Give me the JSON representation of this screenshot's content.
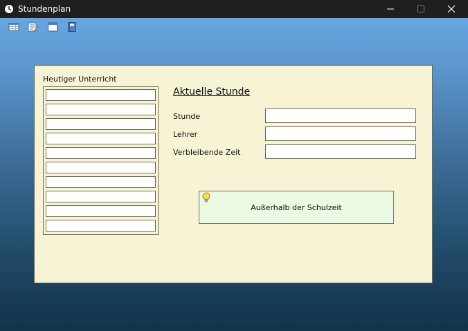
{
  "window": {
    "title": "Stundenplan",
    "app_icon": "clock-icon",
    "controls": [
      "minimize-icon",
      "maximize-icon",
      "close-icon"
    ]
  },
  "toolbar": {
    "buttons": [
      {
        "icon": "table-grid-icon"
      },
      {
        "icon": "edit-list-icon"
      },
      {
        "icon": "window-icon"
      },
      {
        "icon": "book-icon"
      }
    ]
  },
  "today": {
    "title": "Heutiger Unterricht",
    "lessons": [
      "",
      "",
      "",
      "",
      "",
      "",
      "",
      "",
      "",
      ""
    ]
  },
  "current": {
    "title": "Aktuelle Stunde",
    "fields": [
      {
        "label": "Stunde",
        "value": ""
      },
      {
        "label": "Lehrer",
        "value": ""
      },
      {
        "label": "Verbleibende Zeit",
        "value": ""
      }
    ]
  },
  "status": {
    "icon": "lightbulb-icon",
    "text": "Außerhalb der Schulzeit"
  },
  "colors": {
    "panel": "#f7f4d6",
    "status_box": "#ebfbe2",
    "titlebar": "#1f1f1f",
    "gradient_top": "#66a6e2",
    "gradient_bottom": "#12334a"
  }
}
